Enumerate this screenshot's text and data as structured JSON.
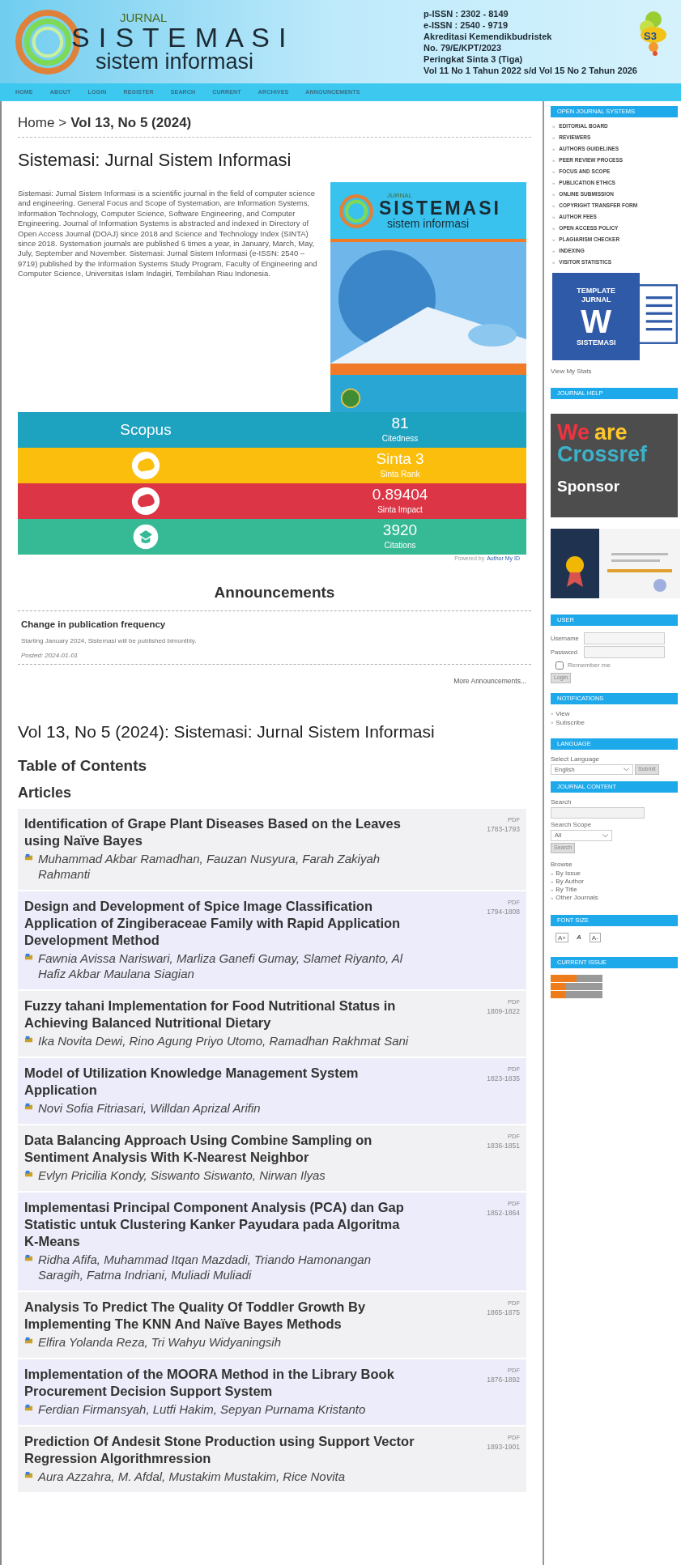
{
  "header": {
    "logo": {
      "small": "JURNAL",
      "big": "S I S T E M A S I",
      "sub": "sistem informasi"
    },
    "info_lines": [
      "p-ISSN : 2302 - 8149",
      "e-ISSN : 2540 - 9719",
      "Akreditasi Kemendikbudristek",
      "No. 79/E/KPT/2023",
      "Peringkat Sinta 3 (Tiga)",
      "Vol 11 No 1 Tahun 2022 s/d Vol 15 No 2 Tahun 2026"
    ],
    "badge": "S3"
  },
  "nav": [
    {
      "label": "HOME"
    },
    {
      "label": "ABOUT"
    },
    {
      "label": "LOGIN"
    },
    {
      "label": "REGISTER"
    },
    {
      "label": "SEARCH"
    },
    {
      "label": "CURRENT"
    },
    {
      "label": "ARCHIVES"
    },
    {
      "label": "ANNOUNCEMENTS"
    }
  ],
  "breadcrumb": {
    "home": "Home",
    "separator": ">",
    "current": "Vol 13, No 5 (2024)"
  },
  "journal_title": "Sistemasi: Jurnal Sistem Informasi",
  "description": "Sistemasi: Jurnal Sistem Informasi is a scientific journal in the field of computer science and engineering. General Focus and Scope of Systemation, are Information Systems, Information Technology, Computer Science, Software Engineering, and Computer Engineering. Journal of Information Systems is abstracted and indexed in Directory of Open Access Journal (DOAJ) since 2018 and Science and Technology Index (SINTA) since 2018. Systemation journals are published 6 times a year, in January, March, May, July, September and November. Sistemasi: Jurnal Sistem Informasi (e-ISSN: 2540 – 9719) published by the Information Systems Study Program, Faculty of Engineering and Computer Science, Universitas Islam Indagiri, Tembilahan  Riau Indonesia.",
  "cover": {
    "small": "JURNAL",
    "big": "SISTEMASI",
    "sub": "sistem informasi"
  },
  "metrics": [
    {
      "kind": "scopus",
      "label": "Scopus",
      "value": "81",
      "caption": "Citedness",
      "color": "#1da2c0"
    },
    {
      "kind": "sinta",
      "value": "Sinta 3",
      "caption": "Sinta Rank",
      "color": "#fbbe0c"
    },
    {
      "kind": "sinta",
      "value": "0.89404",
      "caption": "Sinta Impact",
      "color": "#dc3545"
    },
    {
      "kind": "scholar",
      "value": "3920",
      "caption": "Citations",
      "color": "#36b995"
    }
  ],
  "powered_by": {
    "text": "Powered by",
    "link": "Author My ID"
  },
  "announcements": {
    "heading": "Announcements",
    "items": [
      {
        "title": "Change in publication frequency",
        "body": "Starting January 2024, Sistemasi will be published bimonthly.",
        "posted": "Posted: 2024-01-01"
      }
    ],
    "more": "More Announcements..."
  },
  "issue_title": "Vol 13, No 5 (2024): Sistemasi: Jurnal Sistem Informasi",
  "toc_heading": "Table of Contents",
  "section_heading": "Articles",
  "articles": [
    {
      "title": "Identification of Grape Plant Diseases Based on the Leaves using Naïve Bayes",
      "authors": "Muhammad Akbar Ramadhan, Fauzan Nusyura, Farah Zakiyah Rahmanti",
      "file": "PDF",
      "pages": "1783-1793"
    },
    {
      "title": "Design and Development of Spice Image Classification Application of Zingiberaceae Family with Rapid Application Development Method",
      "authors": "Fawnia Avissa Nariswari, Marliza Ganefi Gumay, Slamet Riyanto, Al Hafiz Akbar Maulana Siagian",
      "file": "PDF",
      "pages": "1794-1808"
    },
    {
      "title": "Fuzzy tahani Implementation for Food Nutritional Status in Achieving Balanced Nutritional Dietary",
      "authors": "Ika Novita Dewi, Rino Agung Priyo Utomo, Ramadhan Rakhmat Sani",
      "file": "PDF",
      "pages": "1809-1822"
    },
    {
      "title": "Model of Utilization Knowledge Management System Application",
      "authors": "Novi Sofia Fitriasari, Willdan Aprizal Arifin",
      "file": "PDF",
      "pages": "1823-1835"
    },
    {
      "title": "Data Balancing Approach Using Combine Sampling on Sentiment Analysis With K-Nearest Neighbor",
      "authors": "Evlyn Pricilia Kondy, Siswanto Siswanto, Nirwan Ilyas",
      "file": "PDF",
      "pages": "1836-1851"
    },
    {
      "title": "Implementasi Principal Component Analysis (PCA) dan Gap Statistic untuk Clustering Kanker Payudara pada Algoritma K-Means",
      "authors": "Ridha Afifa, Muhammad Itqan Mazdadi, Triando Hamonangan Saragih, Fatma Indriani, Muliadi Muliadi",
      "file": "PDF",
      "pages": "1852-1864"
    },
    {
      "title": "Analysis To Predict The Quality Of Toddler Growth By Implementing The KNN And Naïve Bayes Methods",
      "authors": "Elfira Yolanda Reza, Tri Wahyu Widyaningsih",
      "file": "PDF",
      "pages": "1865-1875"
    },
    {
      "title": "Implementation of the MOORA Method in the Library Book Procurement Decision Support System",
      "authors": "Ferdian Firmansyah, Lutfi Hakim, Sepyan Purnama Kristanto",
      "file": "PDF",
      "pages": "1876-1892"
    },
    {
      "title": "Prediction Of Andesit Stone Production using Support Vector Regression Algorithmression",
      "authors": "Aura Azzahra, M. Afdal, Mustakim Mustakim, Rice Novita",
      "file": "PDF",
      "pages": "1893-1901"
    }
  ],
  "sidebar": {
    "bullet": "»",
    "ojs_heading": "OPEN JOURNAL SYSTEMS",
    "menu": [
      "EDITORIAL BOARD",
      "REVIEWERS",
      "AUTHORS GUIDELINES",
      "PEER REVIEW PROCESS",
      "FOCUS AND SCOPE",
      "PUBLICATION ETHICS",
      "ONLINE SUBMISSION",
      "COPYRIGHT TRANSFER FORM",
      "AUTHOR FEES",
      "OPEN ACCESS POLICY",
      "PLAGIARISM CHECKER",
      "INDEXING",
      "VISITOR STATISTICS"
    ],
    "template": {
      "top": "TEMPLATE",
      "mid": "JURNAL",
      "letter": "W",
      "bottom": "SISTEMASI"
    },
    "stats_link": "View My Stats",
    "help_heading": "JOURNAL HELP",
    "sponsor": {
      "line1_a": "We",
      "line1_b": "are",
      "line2": "Crossref",
      "line3": "Sponsor"
    },
    "user": {
      "heading": "USER",
      "username_label": "Username",
      "password_label": "Password",
      "remember": {
        "label": "Remember me",
        "checked": false
      },
      "button": "Login"
    },
    "notifications": {
      "heading": "NOTIFICATIONS",
      "links": [
        "View",
        "Subscribe"
      ]
    },
    "language": {
      "heading": "LANGUAGE",
      "label": "Select Language",
      "value": "English",
      "button": "Submit"
    },
    "content": {
      "heading": "JOURNAL CONTENT",
      "search_label": "Search",
      "scope_label": "Search Scope",
      "scope_value": "All",
      "button": "Search",
      "browse_label": "Browse",
      "browse_links": [
        "By Issue",
        "By Author",
        "By Title",
        "Other Journals"
      ]
    },
    "font_size": {
      "heading": "FONT SIZE",
      "buttons": [
        "A+",
        "A",
        "A-"
      ]
    },
    "current_issue_heading": "CURRENT ISSUE"
  }
}
